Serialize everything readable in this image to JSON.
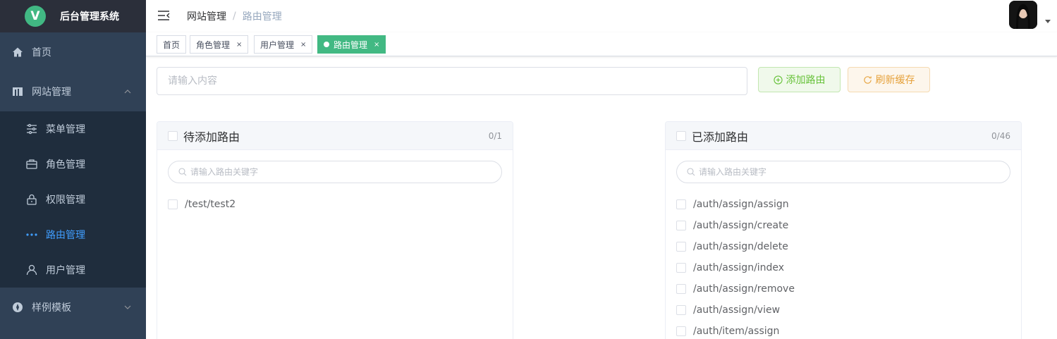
{
  "app": {
    "title": "后台管理系统",
    "logo_letter": "V"
  },
  "sidebar": {
    "items": [
      {
        "label": "首页"
      },
      {
        "label": "网站管理"
      },
      {
        "label": "样例模板"
      }
    ],
    "sub": [
      {
        "label": "菜单管理"
      },
      {
        "label": "角色管理"
      },
      {
        "label": "权限管理"
      },
      {
        "label": "路由管理"
      },
      {
        "label": "用户管理"
      }
    ]
  },
  "breadcrumb": {
    "parent": "网站管理",
    "separator": "/",
    "current": "路由管理"
  },
  "tags": [
    {
      "label": "首页"
    },
    {
      "label": "角色管理"
    },
    {
      "label": "用户管理"
    },
    {
      "label": "路由管理"
    }
  ],
  "tag_close": "×",
  "search": {
    "placeholder": "请输入内容"
  },
  "buttons": {
    "add_route": "添加路由",
    "refresh_cache": "刷新缓存"
  },
  "left_panel": {
    "title": "待添加路由",
    "count": "0/1",
    "filter_placeholder": "请输入路由关键字",
    "items": [
      "/test/test2"
    ]
  },
  "right_panel": {
    "title": "已添加路由",
    "count": "0/46",
    "filter_placeholder": "请输入路由关键字",
    "items": [
      "/auth/assign/assign",
      "/auth/assign/create",
      "/auth/assign/delete",
      "/auth/assign/index",
      "/auth/assign/remove",
      "/auth/assign/view",
      "/auth/item/assign"
    ]
  },
  "colors": {
    "sidebar_bg": "#304156",
    "submenu_bg": "#1f2d3d",
    "active_menu": "#409eff",
    "active_tag": "#42b983",
    "success": "#67c23a",
    "warning": "#e6a23c"
  },
  "icons": {
    "home": "home-icon",
    "site": "building-icon",
    "menu": "sliders-icon",
    "role": "briefcase-icon",
    "permission": "lock-icon",
    "route": "more-dots-icon",
    "user": "user-icon",
    "template": "compass-icon"
  }
}
